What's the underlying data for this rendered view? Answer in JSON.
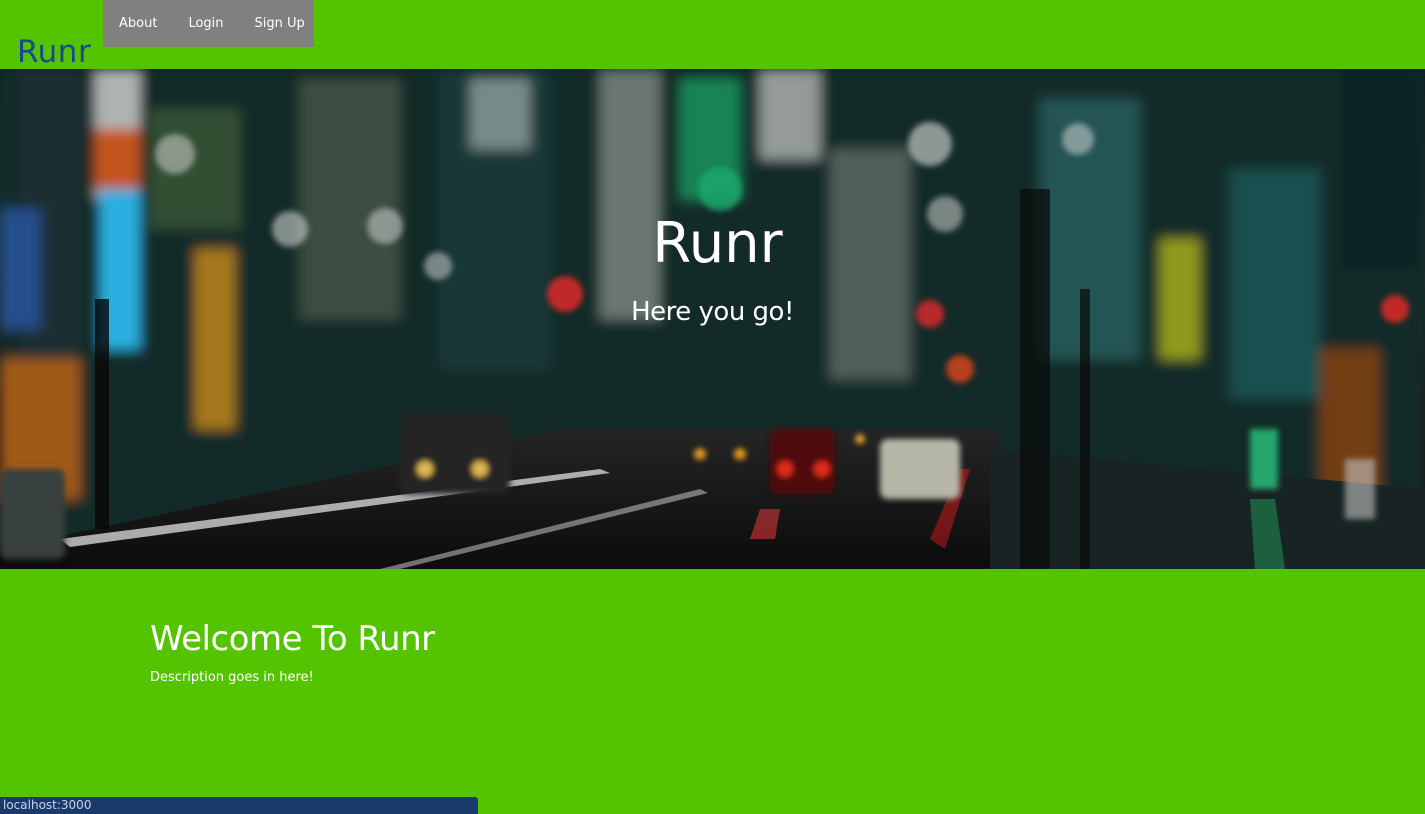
{
  "brand": {
    "name": "Runr",
    "color": "#1a4a8c"
  },
  "nav": {
    "items": [
      {
        "label": "About"
      },
      {
        "label": "Login"
      },
      {
        "label": "Sign Up"
      }
    ],
    "background": "#808080"
  },
  "hero": {
    "title": "Runr",
    "subtitle": "Here you go!"
  },
  "main": {
    "heading": "Welcome To Runr",
    "description": "Description goes in here!"
  },
  "status_bar": {
    "url": "localhost:3000"
  },
  "colors": {
    "page_background": "#54c400",
    "text": "#ffffff"
  }
}
